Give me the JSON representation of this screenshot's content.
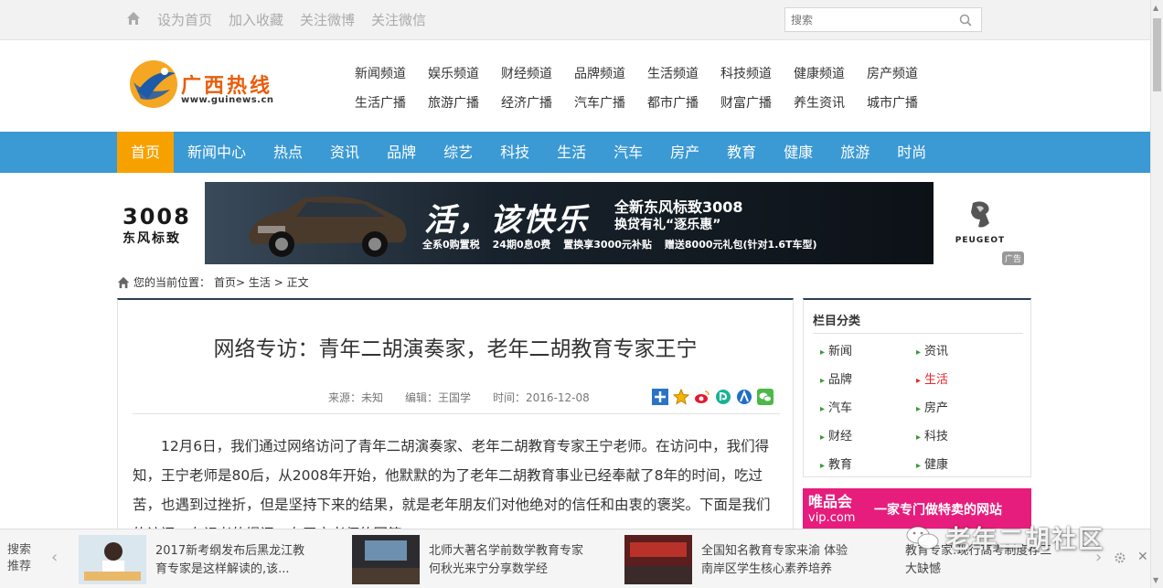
{
  "topbar": {
    "links": [
      "设为首页",
      "加入收藏",
      "关注微博",
      "关注微信"
    ],
    "search_placeholder": "搜索"
  },
  "logo": {
    "name": "广西热线",
    "url": "www.guinews.cn"
  },
  "channels": [
    "新闻频道",
    "娱乐频道",
    "财经频道",
    "品牌频道",
    "生活频道",
    "科技频道",
    "健康频道",
    "房产频道",
    "生活广播",
    "旅游广播",
    "经济广播",
    "汽车广播",
    "都市广播",
    "财富广播",
    "养生资讯",
    "城市广播"
  ],
  "nav": [
    "首页",
    "新闻中心",
    "热点",
    "资讯",
    "品牌",
    "综艺",
    "科技",
    "生活",
    "汽车",
    "房产",
    "教育",
    "健康",
    "旅游",
    "时尚"
  ],
  "ad": {
    "left_model": "3008",
    "left_brand": "东风标致",
    "slogan": "活，该快乐",
    "sub1": "全新东风标致3008",
    "sub2": "换贷有礼“逐乐惠”",
    "offers": [
      "全系0购置税",
      "24期0息0费",
      "置换享3000元补贴",
      "赠送8000元礼包(针对1.6T车型)"
    ],
    "brand_logo_text": "PEUGEOT",
    "tag": "广告"
  },
  "breadcrumb": {
    "prefix": "您的当前位置：",
    "path": "首页> 生活 > 正文"
  },
  "article": {
    "title": "网络专访：青年二胡演奏家，老年二胡教育专家王宁",
    "source": "来源：未知",
    "editor": "编辑：王国学",
    "time": "时间：2016-12-08",
    "body": "12月6日，我们通过网络访问了青年二胡演奏家、老年二胡教育专家王宁老师。在访问中，我们得知，王宁老师是80后，从2008年开始，他默默的为了老年二胡教育事业已经奉献了8年的时间，吃过苦，也遇到过挫折，但是坚持下来的结果，就是老年朋友们对他绝对的信任和由衷的褒奖。下面是我们的访问，有记者的提问，有王宁老师的回答。"
  },
  "sidebar": {
    "title": "栏目分类",
    "categories": [
      "新闻",
      "资讯",
      "品牌",
      "生活",
      "汽车",
      "房产",
      "财经",
      "科技",
      "教育",
      "健康"
    ],
    "active": "生活"
  },
  "vip": {
    "brand": "唯品会",
    "domain": "vip.com",
    "slogan": "一家专门做特卖的网站"
  },
  "bottom": {
    "label_line1": "搜索",
    "label_line2": "推荐",
    "items": [
      "2017新考纲发布后黑龙江教育专家是这样解读的,该...",
      "北师大著名学前数学教育专家何秋光来宁分享数学经",
      "全国知名教育专家来渝 体验南岸区学生核心素养培养",
      "教育专家:现行高考制度存三大缺憾"
    ]
  },
  "watermark": "老年二胡社区",
  "colors": {
    "nav_bg": "#3b99d3",
    "nav_active": "#f7a100",
    "logo_orange": "#e95d0c",
    "vip_pink": "#e61d7c",
    "active_red": "#e5282c"
  }
}
